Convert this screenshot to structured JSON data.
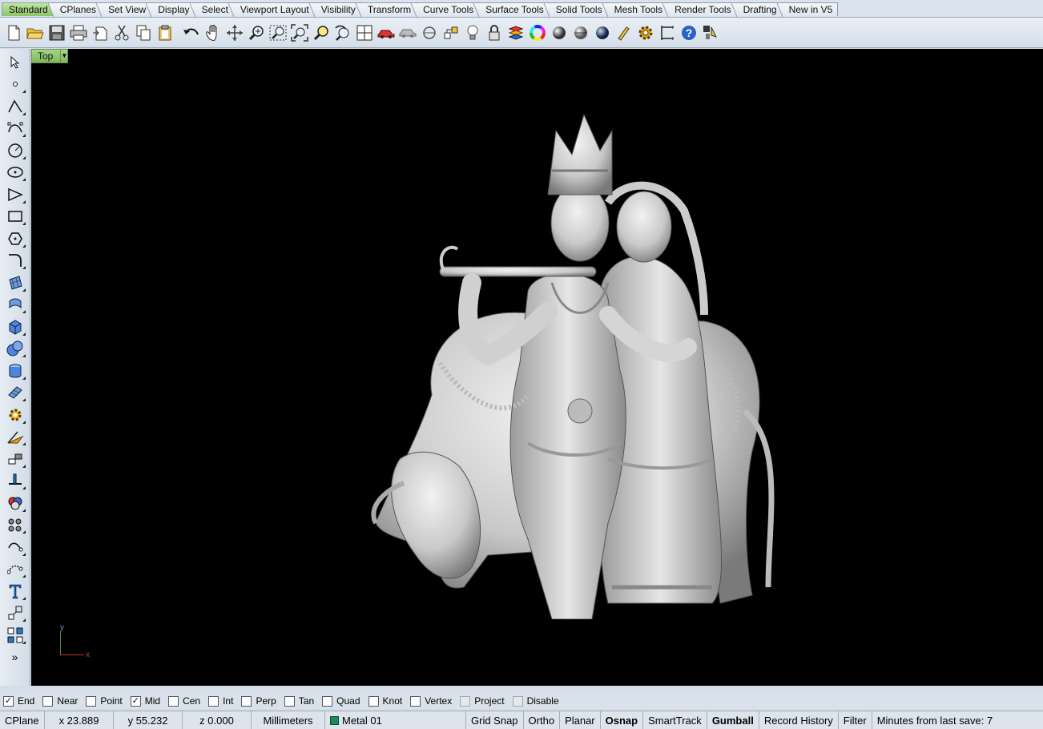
{
  "tabs": [
    {
      "label": "Standard",
      "active": true
    },
    {
      "label": "CPlanes"
    },
    {
      "label": "Set View"
    },
    {
      "label": "Display"
    },
    {
      "label": "Select"
    },
    {
      "label": "Viewport Layout"
    },
    {
      "label": "Visibility"
    },
    {
      "label": "Transform"
    },
    {
      "label": "Curve Tools"
    },
    {
      "label": "Surface Tools"
    },
    {
      "label": "Solid Tools"
    },
    {
      "label": "Mesh Tools"
    },
    {
      "label": "Render Tools"
    },
    {
      "label": "Drafting"
    },
    {
      "label": "New in V5"
    }
  ],
  "toolbar": {
    "icons": [
      "new-file-icon",
      "open-file-icon",
      "save-icon",
      "print-icon",
      "import-icon",
      "cut-icon",
      "copy-icon",
      "paste-icon",
      "undo-icon",
      "pan-hand-icon",
      "rotate-view-icon",
      "zoom-icon",
      "zoom-window-icon",
      "zoom-extents-icon",
      "zoom-selected-icon",
      "undo-view-icon",
      "viewport-layout-icon",
      "car-icon",
      "shaded-icon",
      "circle-arrows-icon",
      "snap-icon",
      "light-bulb-icon",
      "lock-icon",
      "layer-icon",
      "color-wheel-icon",
      "render-sphere-icon",
      "material-sphere-icon",
      "environment-sphere-icon",
      "edit-tools-icon",
      "options-gear-icon",
      "dimension-icon",
      "help-icon",
      "toolbar-layout-icon"
    ]
  },
  "viewport": {
    "label": "Top",
    "axis_x": "x",
    "axis_y": "y"
  },
  "osnaps": [
    {
      "label": "End",
      "checked": true
    },
    {
      "label": "Near",
      "checked": false
    },
    {
      "label": "Point",
      "checked": false
    },
    {
      "label": "Mid",
      "checked": true
    },
    {
      "label": "Cen",
      "checked": false
    },
    {
      "label": "Int",
      "checked": false
    },
    {
      "label": "Perp",
      "checked": false
    },
    {
      "label": "Tan",
      "checked": false
    },
    {
      "label": "Quad",
      "checked": false
    },
    {
      "label": "Knot",
      "checked": false
    },
    {
      "label": "Vertex",
      "checked": false
    },
    {
      "label": "Project",
      "checked": false,
      "disabled": true
    },
    {
      "label": "Disable",
      "checked": false,
      "disabled": true
    }
  ],
  "status": {
    "cplane": "CPlane",
    "x": "x 23.889",
    "y": "y 55.232",
    "z": "z 0.000",
    "units": "Millimeters",
    "layer": "Metal 01",
    "grid_snap": "Grid Snap",
    "ortho": "Ortho",
    "planar": "Planar",
    "osnap": "Osnap",
    "smarttrack": "SmartTrack",
    "gumball": "Gumball",
    "record_history": "Record History",
    "filter": "Filter",
    "save_info": "Minutes from last save: 7",
    "layer_color": "#1d8a5e"
  }
}
